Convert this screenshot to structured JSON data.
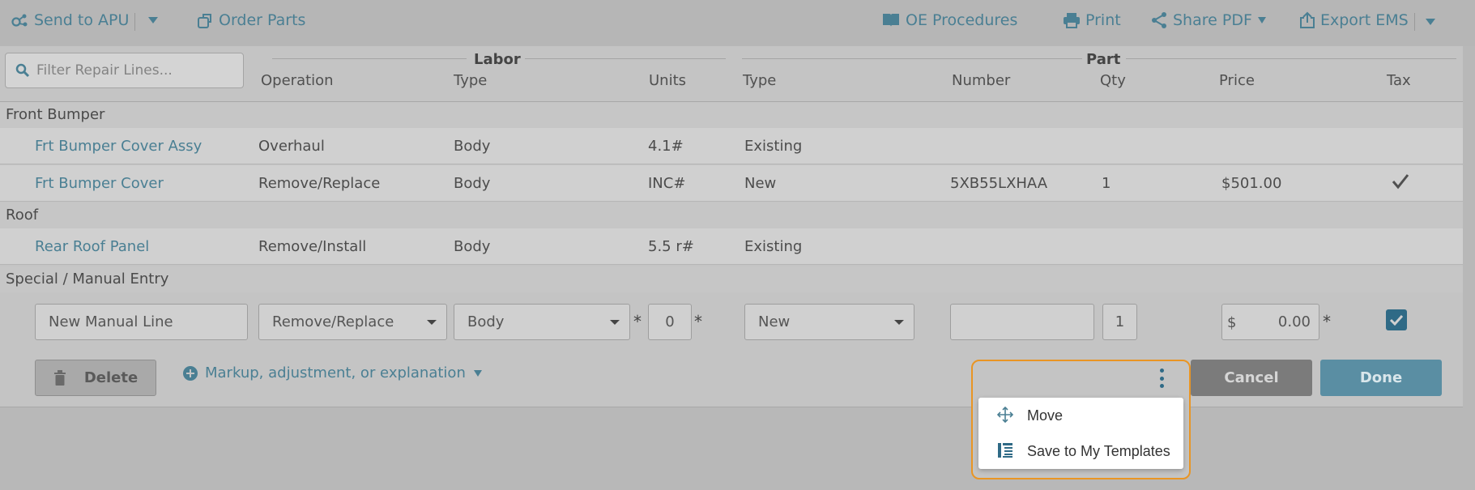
{
  "toolbar": {
    "send_to_apu": "Send to APU",
    "order_parts": "Order Parts",
    "oe_procedures": "OE Procedures",
    "print": "Print",
    "share_pdf": "Share PDF",
    "export_ems": "Export EMS"
  },
  "filter": {
    "placeholder": "Filter Repair Lines..."
  },
  "headers": {
    "labor_group": "Labor",
    "part_group": "Part",
    "columns": [
      "Operation",
      "Type",
      "Units",
      "Type",
      "Number",
      "Qty",
      "Price",
      "Tax"
    ]
  },
  "sections": [
    {
      "title": "Front Bumper",
      "rows": [
        {
          "description": "Frt Bumper Cover Assy",
          "operation": "Overhaul",
          "labor_type": "Body",
          "units": "4.1#",
          "part_type": "Existing",
          "number": "",
          "qty": "",
          "price": "",
          "tax": false
        },
        {
          "description": "Frt Bumper Cover",
          "operation": "Remove/Replace",
          "labor_type": "Body",
          "units": "INC#",
          "part_type": "New",
          "number": "5XB55LXHAA",
          "qty": "1",
          "price": "$501.00",
          "tax": true
        }
      ]
    },
    {
      "title": "Roof",
      "rows": [
        {
          "description": "Rear Roof Panel",
          "operation": "Remove/Install",
          "labor_type": "Body",
          "units": "5.5 r#",
          "part_type": "Existing",
          "number": "",
          "qty": "",
          "price": "",
          "tax": false
        }
      ]
    },
    {
      "title": "Special / Manual Entry",
      "rows": []
    }
  ],
  "edit_row": {
    "description": "New Manual Line",
    "operation": "Remove/Replace",
    "labor_type": "Body",
    "units": "0",
    "part_type": "New",
    "number": "",
    "qty": "1",
    "price_currency": "$",
    "price": "0.00",
    "tax": true,
    "asterisk": "*"
  },
  "actions": {
    "delete": "Delete",
    "markup": "Markup, adjustment, or explanation",
    "cancel": "Cancel",
    "done": "Done"
  },
  "context_menu": {
    "items": [
      {
        "label": "Move",
        "icon": "move-icon"
      },
      {
        "label": "Save to My Templates",
        "icon": "template-icon"
      }
    ]
  },
  "colors": {
    "accent": "#4a7f93",
    "done": "#5a8ea3",
    "popup_border": "#e99524",
    "checkbox": "#2f6a86"
  }
}
